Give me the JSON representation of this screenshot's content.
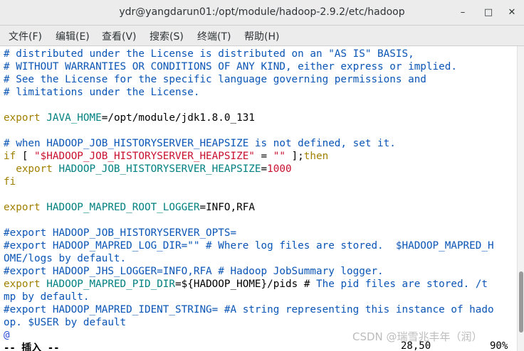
{
  "window": {
    "title": "ydr@yangdarun01:/opt/module/hadoop-2.9.2/etc/hadoop",
    "minimize_symbol": "–",
    "maximize_symbol": "□",
    "close_symbol": "✕",
    "icons": {
      "minimize": "minimize-icon",
      "maximize": "maximize-icon",
      "close": "close-icon"
    }
  },
  "menu": {
    "items": [
      "文件(F)",
      "编辑(E)",
      "查看(V)",
      "搜索(S)",
      "终端(T)",
      "帮助(H)"
    ]
  },
  "editor": {
    "lines": [
      [
        {
          "t": "# distributed under the License is distributed on an \"AS IS\" BASIS,",
          "c": "comment"
        }
      ],
      [
        {
          "t": "# WITHOUT WARRANTIES OR CONDITIONS OF ANY KIND, either express or implied.",
          "c": "comment"
        }
      ],
      [
        {
          "t": "# See the License for the specific language governing permissions and",
          "c": "comment"
        }
      ],
      [
        {
          "t": "# limitations under the License.",
          "c": "comment"
        }
      ],
      [],
      [
        {
          "t": "export ",
          "c": "key"
        },
        {
          "t": "JAVA_HOME",
          "c": "var"
        },
        {
          "t": "=",
          "c": "plain"
        },
        {
          "t": "/opt/module/jdk1.8.0_131",
          "c": "plain"
        }
      ],
      [],
      [
        {
          "t": "# when HADOOP_JOB_HISTORYSERVER_HEAPSIZE is not defined, set it.",
          "c": "comment"
        }
      ],
      [
        {
          "t": "if",
          "c": "key"
        },
        {
          "t": " [ ",
          "c": "plain"
        },
        {
          "t": "\"$HADOOP_JOB_HISTORYSERVER_HEAPSIZE\"",
          "c": "str"
        },
        {
          "t": " = ",
          "c": "plain"
        },
        {
          "t": "\"\"",
          "c": "str"
        },
        {
          "t": " ];",
          "c": "plain"
        },
        {
          "t": "then",
          "c": "key"
        }
      ],
      [
        {
          "t": "  export ",
          "c": "key"
        },
        {
          "t": "HADOOP_JOB_HISTORYSERVER_HEAPSIZE",
          "c": "var"
        },
        {
          "t": "=",
          "c": "plain"
        },
        {
          "t": "1000",
          "c": "str"
        }
      ],
      [
        {
          "t": "fi",
          "c": "key"
        }
      ],
      [],
      [
        {
          "t": "export ",
          "c": "key"
        },
        {
          "t": "HADOOP_MAPRED_ROOT_LOGGER",
          "c": "var"
        },
        {
          "t": "=",
          "c": "plain"
        },
        {
          "t": "INFO,RFA",
          "c": "plain"
        }
      ],
      [],
      [
        {
          "t": "#export HADOOP_JOB_HISTORYSERVER_OPTS=",
          "c": "comment"
        }
      ],
      [
        {
          "t": "#export HADOOP_MAPRED_LOG_DIR=\"\" # Where log files are stored.  $HADOOP_MAPRED_H",
          "c": "comment"
        }
      ],
      [
        {
          "t": "OME/logs by default.",
          "c": "comment"
        }
      ],
      [
        {
          "t": "#export HADOOP_JHS_LOGGER=INFO,RFA # Hadoop JobSummary logger.",
          "c": "comment"
        }
      ],
      [
        {
          "t": "export ",
          "c": "key"
        },
        {
          "t": "HADOOP_MAPRED_PID_DIR",
          "c": "var"
        },
        {
          "t": "=",
          "c": "plain"
        },
        {
          "t": "${HADOOP_HOME}",
          "c": "plain"
        },
        {
          "t": "/pids ",
          "c": "plain"
        },
        {
          "t": "#",
          "c": "cursor"
        },
        {
          "t": " The pid files are stored. /t",
          "c": "comment"
        }
      ],
      [
        {
          "t": "mp by default.",
          "c": "comment"
        }
      ],
      [
        {
          "t": "#export HADOOP_MAPRED_IDENT_STRING= #A string representing this instance of hado",
          "c": "comment"
        }
      ],
      [
        {
          "t": "op. $USER by default",
          "c": "comment"
        }
      ],
      [
        {
          "t": "@",
          "c": "tilde"
        }
      ]
    ]
  },
  "status": {
    "mode": "-- 插入 --",
    "position": "28,50",
    "percent": "90%"
  },
  "watermark": "CSDN @瑞雪兆丰年（润）",
  "scrollbar": {
    "thumb_start": 0.74,
    "thumb_extent": 0.2
  },
  "colors": {
    "comment": "#0a55b5",
    "keyword": "#a08000",
    "variable": "#008080",
    "string": "#c8102e",
    "plain": "#000000"
  }
}
